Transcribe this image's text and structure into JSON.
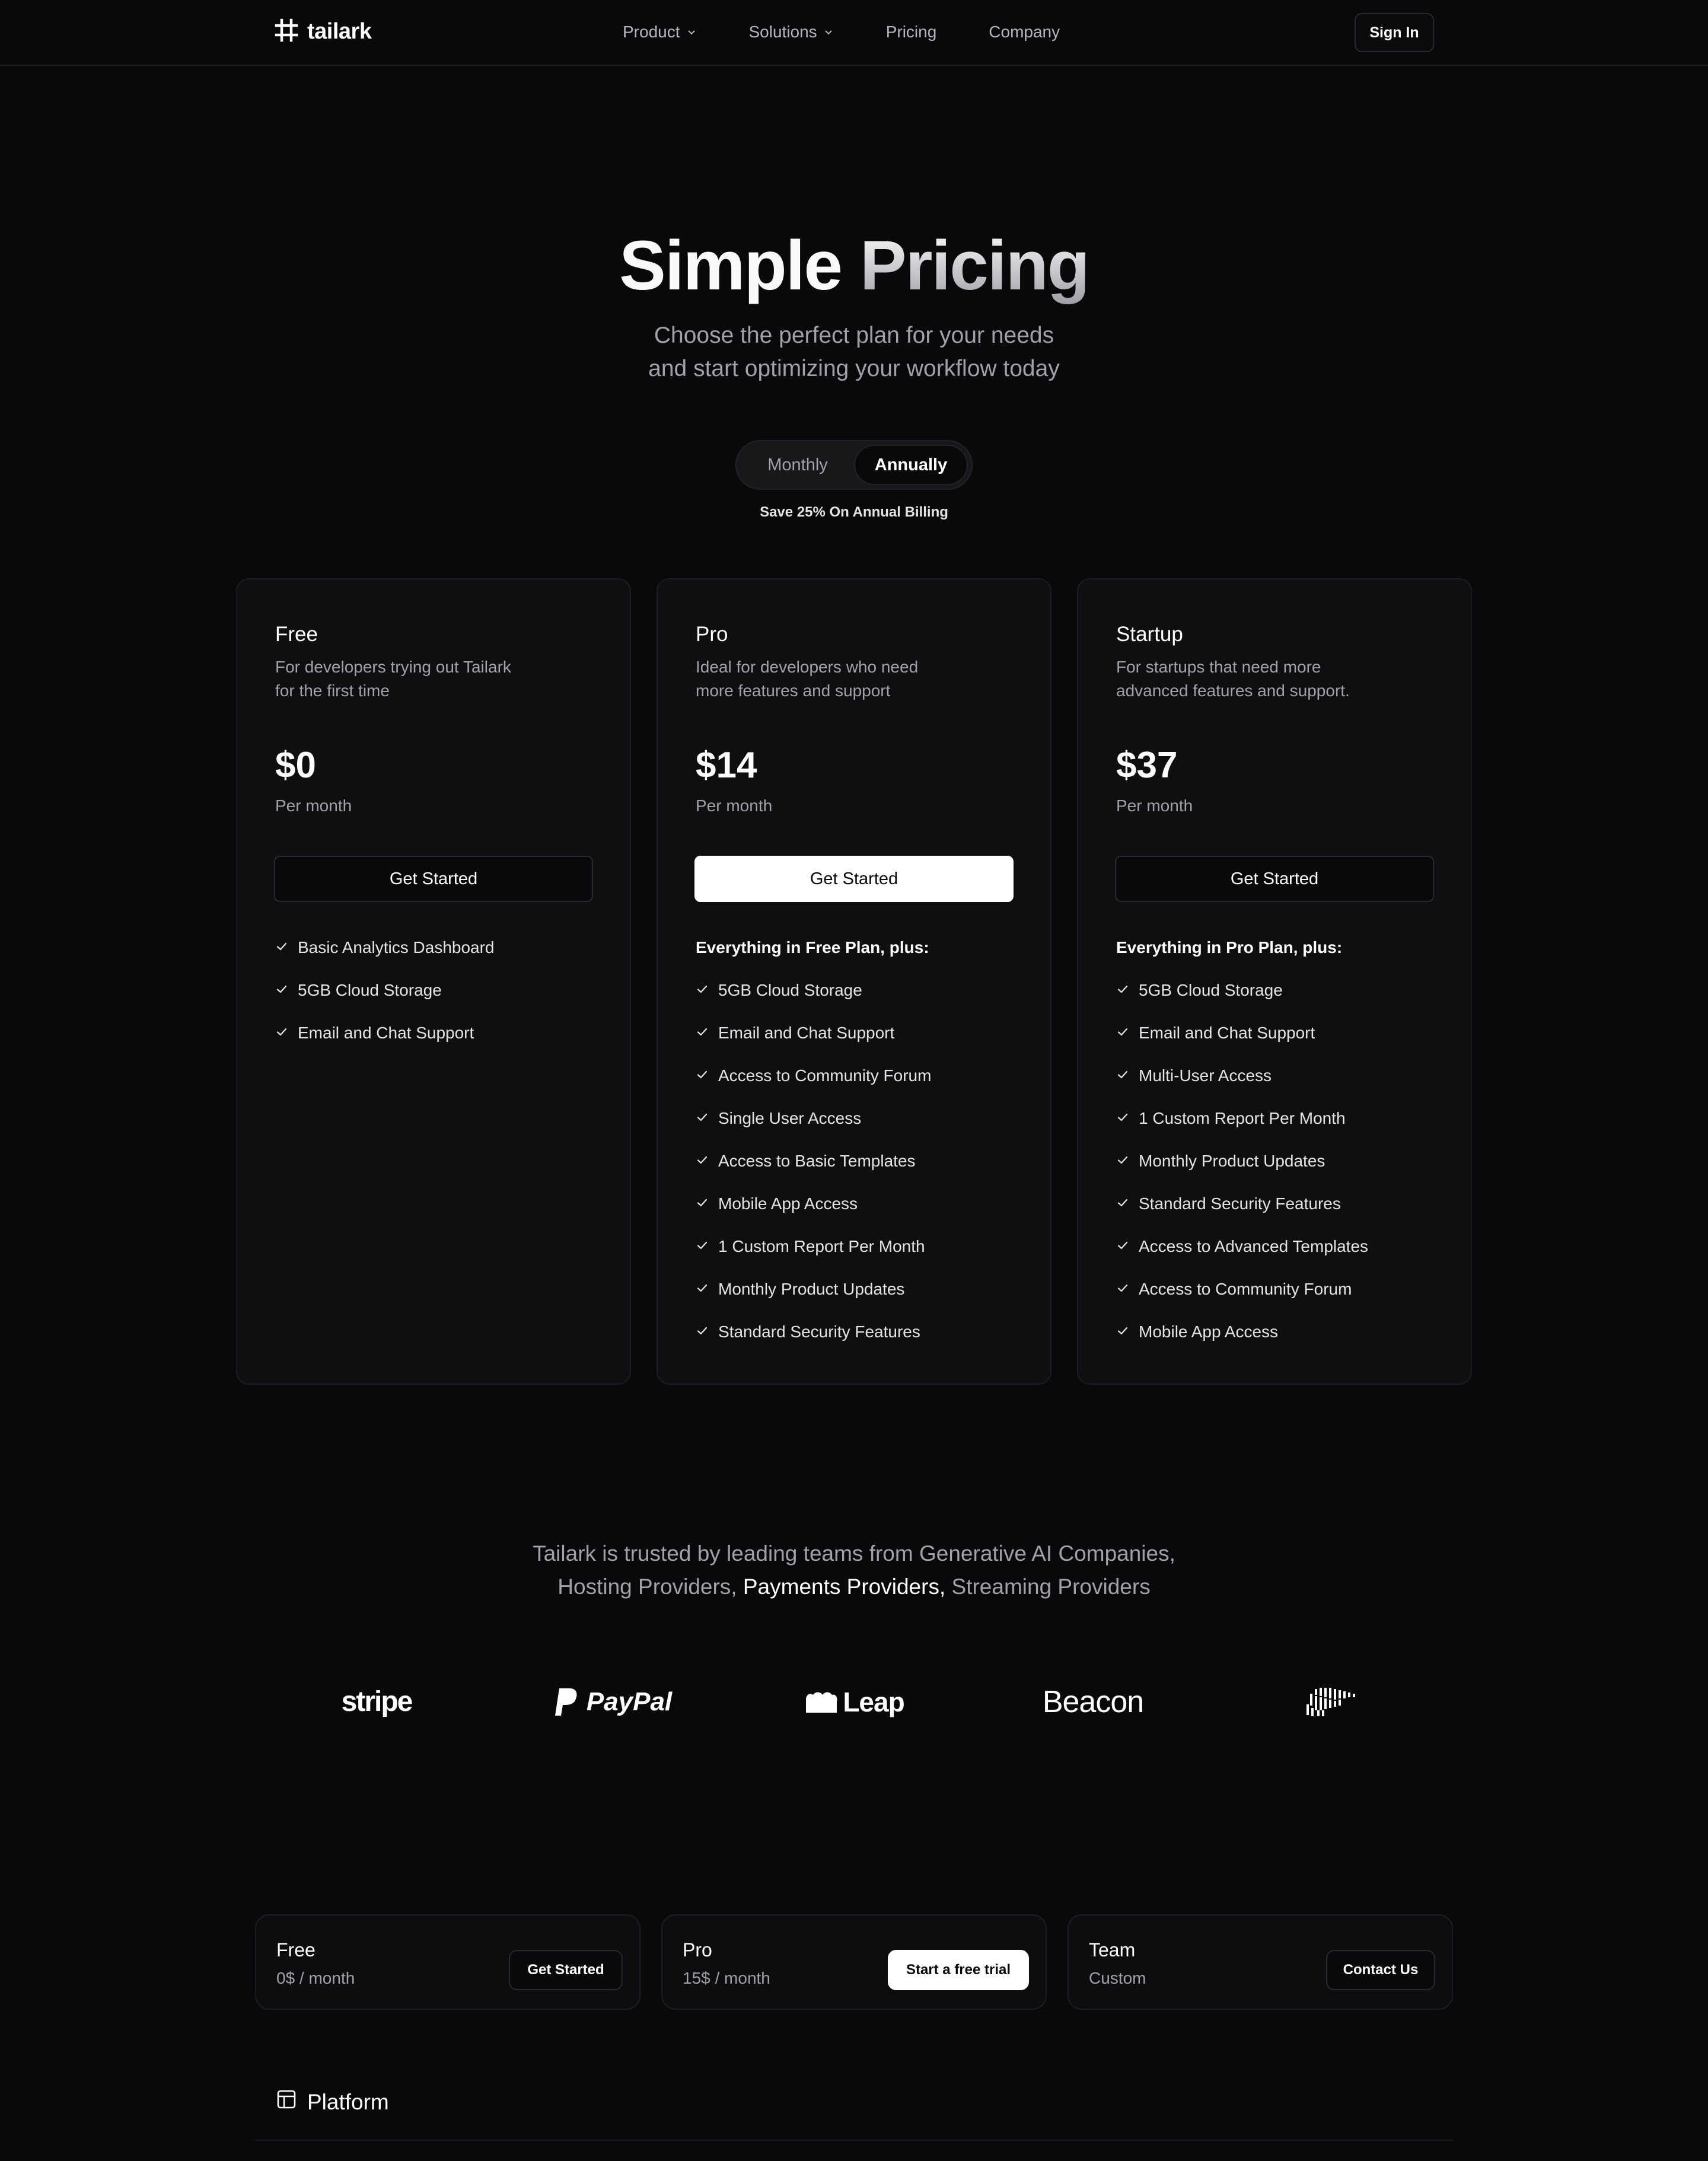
{
  "nav": {
    "logo_text": "tailark",
    "links": [
      {
        "label": "Product",
        "has_dropdown": true
      },
      {
        "label": "Solutions",
        "has_dropdown": true
      },
      {
        "label": "Pricing",
        "has_dropdown": false
      },
      {
        "label": "Company",
        "has_dropdown": false
      }
    ],
    "sign_in_label": "Sign In"
  },
  "hero": {
    "title_part1": "Simple",
    "title_part2": "Pricing",
    "subtitle_line1": "Choose the perfect plan for your needs",
    "subtitle_line2": "and start optimizing your workflow today"
  },
  "billing_toggle": {
    "options": [
      "Monthly",
      "Annually"
    ],
    "selected": "Annually",
    "note": "Save 25% On Annual Billing"
  },
  "plans": [
    {
      "name": "Free",
      "description": "For developers trying out Tailark for the first time",
      "price": "$0",
      "period": "Per month",
      "button_label": "Get Started",
      "highlighted": false,
      "intro": "",
      "features": [
        "Basic Analytics Dashboard",
        "5GB Cloud Storage",
        "Email and Chat Support"
      ]
    },
    {
      "name": "Pro",
      "description": "Ideal for developers who need more features and support",
      "price": "$14",
      "period": "Per month",
      "button_label": "Get Started",
      "highlighted": true,
      "intro": "Everything in Free Plan, plus:",
      "features": [
        "5GB Cloud Storage",
        "Email and Chat Support",
        "Access to Community Forum",
        "Single User Access",
        "Access to Basic Templates",
        "Mobile App Access",
        "1 Custom Report Per Month",
        "Monthly Product Updates",
        "Standard Security Features"
      ]
    },
    {
      "name": "Startup",
      "description": "For startups that need more advanced features and support.",
      "price": "$37",
      "period": "Per month",
      "button_label": "Get Started",
      "highlighted": false,
      "intro": "Everything in Pro Plan, plus:",
      "features": [
        "5GB Cloud Storage",
        "Email and Chat Support",
        "Multi-User Access",
        "1 Custom Report Per Month",
        "Monthly Product Updates",
        "Standard Security Features",
        "Access to Advanced Templates",
        "Access to Community Forum",
        "Mobile App Access"
      ]
    }
  ],
  "trust": {
    "line1": "Tailark is trusted by leading teams from Generative AI Companies,",
    "line2_a": "Hosting Providers,",
    "line2_b": "Payments Providers,",
    "line2_c": "Streaming Providers",
    "logos": [
      "stripe",
      "PayPal",
      "Leap",
      "Beacon",
      "bear-logo"
    ]
  },
  "compare": {
    "plans": [
      {
        "name": "Free",
        "price": "0$ / month",
        "button_label": "Get Started",
        "primary": false
      },
      {
        "name": "Pro",
        "price": "15$ / month",
        "button_label": "Start a free trial",
        "primary": true
      },
      {
        "name": "Team",
        "price": "Custom",
        "button_label": "Contact Us",
        "primary": false
      }
    ],
    "section_title": "Platform",
    "section_icon": "layout-icon"
  },
  "colors": {
    "background": "#09090b",
    "card": "#0f0f12",
    "border": "#1e1e22",
    "muted_text": "#a1a1aa",
    "primary_button": "#ffffff"
  }
}
